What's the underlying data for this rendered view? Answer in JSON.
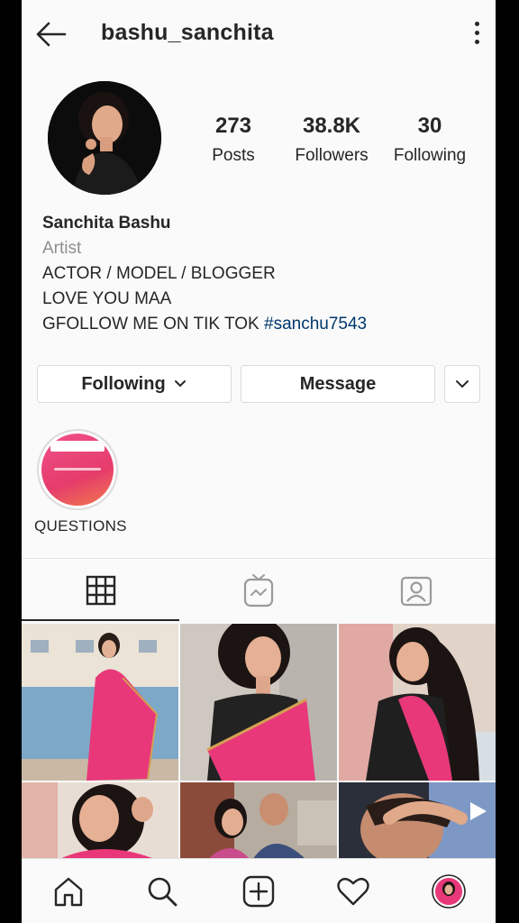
{
  "header": {
    "username": "bashu_sanchita"
  },
  "stats": [
    {
      "value": "273",
      "label": "Posts"
    },
    {
      "value": "38.8K",
      "label": "Followers"
    },
    {
      "value": "30",
      "label": "Following"
    }
  ],
  "bio": {
    "name": "Sanchita Bashu",
    "category": "Artist",
    "line1": "ACTOR / MODEL / BLOGGER",
    "line2": "LOVE YOU MAA",
    "line3_text": "GFOLLOW ME ON TIK TOK ",
    "line3_tag": "#sanchu7543"
  },
  "buttons": {
    "following": "Following",
    "message": "Message"
  },
  "highlight": {
    "label": "QUESTIONS"
  },
  "tabs": [
    "grid-icon",
    "igtv-icon",
    "tagged-icon"
  ],
  "nav": [
    "home-icon",
    "search-icon",
    "new-post-icon",
    "activity-heart-icon",
    "profile-avatar"
  ],
  "colors": {
    "pink": "#e8387a",
    "link": "#00376b",
    "text": "#262626"
  }
}
